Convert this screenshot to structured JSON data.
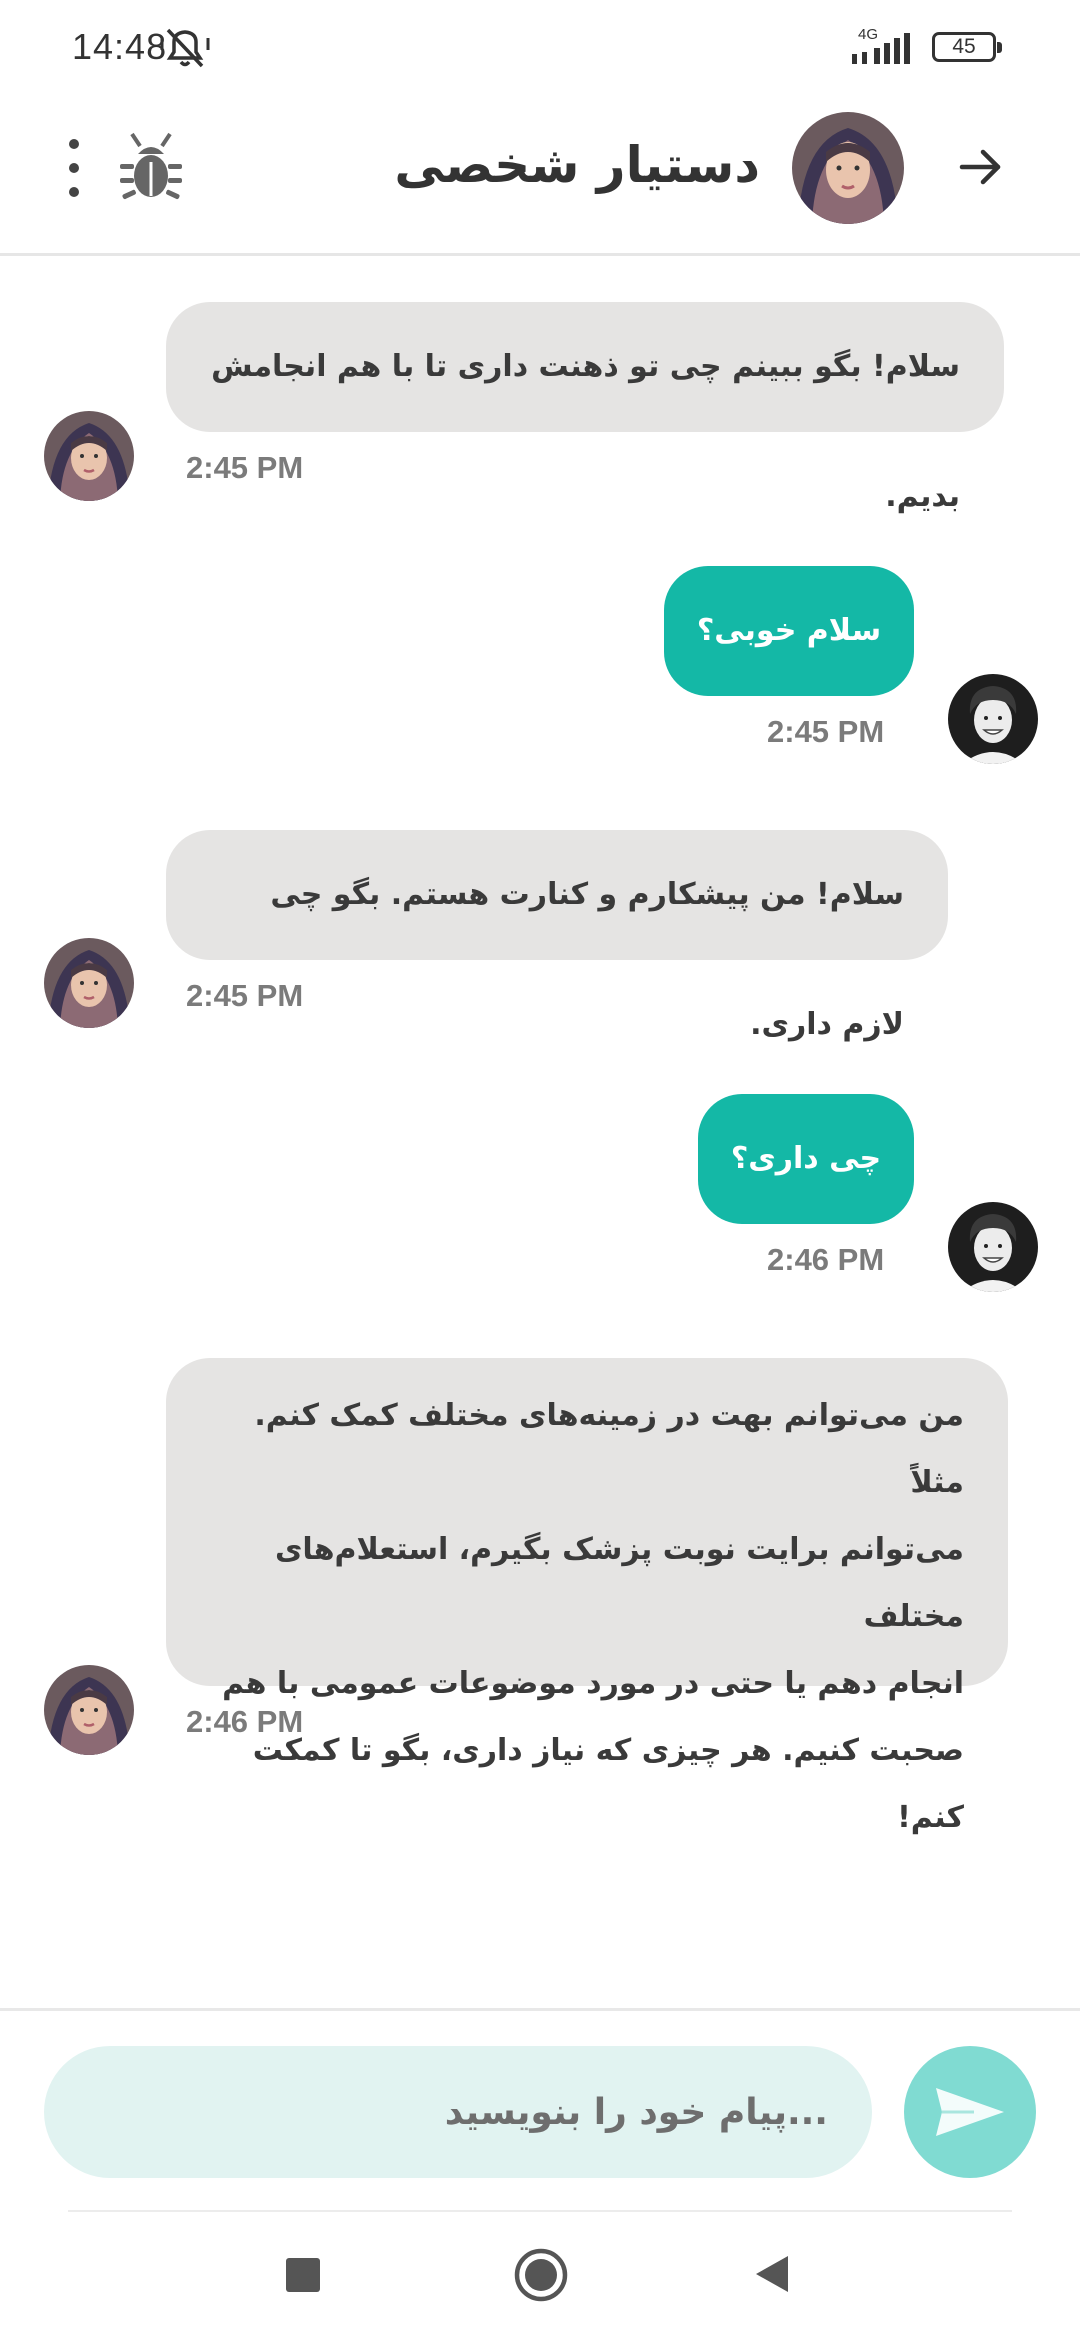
{
  "status_bar": {
    "time": "14:48",
    "network": "4G",
    "battery": "45"
  },
  "header": {
    "title": "دستیار شخصی",
    "icons": [
      "menu-dots-icon",
      "bug-icon",
      "bot-avatar",
      "arrow-right-icon"
    ]
  },
  "messages": [
    {
      "sender": "bot",
      "text": "سلام! بگو ببینم چی تو ذهنت داری تا با هم انجامش بدیم.",
      "time": "2:45 PM"
    },
    {
      "sender": "user",
      "text": "سلام خوبی؟",
      "time": "2:45 PM"
    },
    {
      "sender": "bot",
      "text": "سلام! من پیشکارم و کنارت هستم. بگو چی لازم داری.",
      "time": "2:45 PM"
    },
    {
      "sender": "user",
      "text": "چی داری؟",
      "time": "2:46 PM"
    },
    {
      "sender": "bot",
      "lines": [
        "من می‌توانم بهت در زمینه‌های مختلف کمک کنم. مثلاً",
        "می‌توانم برایت نوبت پزشک بگیرم، استعلام‌های مختلف",
        "انجام دهم یا حتی در مورد موضوعات عمومی با هم",
        "صحبت کنیم. هر چیزی که نیاز داری، بگو تا کمکت کنم!"
      ],
      "time": "2:46 PM"
    }
  ],
  "composer": {
    "placeholder": "...پیام خود را بنویسید",
    "send_icon": "send-icon"
  },
  "colors": {
    "user_bubble": "#14b8a6",
    "bot_bubble": "#e5e4e3",
    "send_button": "#80dbd2",
    "input_bg": "#e1f3f1"
  }
}
